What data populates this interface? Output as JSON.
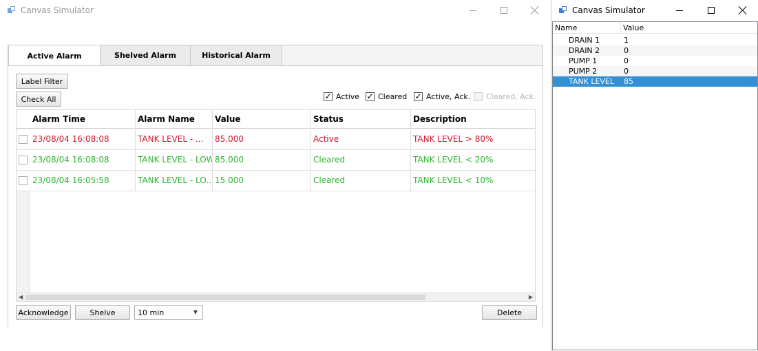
{
  "main_window": {
    "title": "Canvas Simulator",
    "tabs": [
      {
        "label": "Active Alarm",
        "active": true
      },
      {
        "label": "Shelved Alarm",
        "active": false
      },
      {
        "label": "Historical Alarm",
        "active": false
      }
    ],
    "buttons": {
      "label_filter": "Label Filter",
      "check_all": "Check All",
      "acknowledge": "Acknowledge",
      "shelve": "Shelve",
      "delete": "Delete"
    },
    "filters": [
      {
        "label": "Active",
        "checked": true,
        "enabled": true
      },
      {
        "label": "Cleared",
        "checked": true,
        "enabled": true
      },
      {
        "label": "Active, Ack.",
        "checked": true,
        "enabled": true
      },
      {
        "label": "Cleared, Ack.",
        "checked": false,
        "enabled": false
      }
    ],
    "shelve_duration": "10 min",
    "table": {
      "columns": [
        "Alarm Time",
        "Alarm Name",
        "Value",
        "Status",
        "Description"
      ],
      "rows": [
        {
          "time": "23/08/04 16:08:08",
          "name": "TANK LEVEL - ...",
          "value": "85.000",
          "status": "Active",
          "description": "TANK LEVEL > 80%",
          "color": "#c8192a"
        },
        {
          "time": "23/08/04 16:08:08",
          "name": "TANK LEVEL - LOW",
          "value": "85.000",
          "status": "Cleared",
          "description": "TANK LEVEL < 20%",
          "color": "#2db52d"
        },
        {
          "time": "23/08/04 16:05:58",
          "name": "TANK LEVEL - LO...",
          "value": "15.000",
          "status": "Cleared",
          "description": "TANK LEVEL < 10%",
          "color": "#2db52d"
        }
      ]
    }
  },
  "side_window": {
    "title": "Canvas Simulator",
    "columns": [
      "Name",
      "Value"
    ],
    "rows": [
      {
        "name": "DRAIN 1",
        "value": "1"
      },
      {
        "name": "DRAIN 2",
        "value": "0"
      },
      {
        "name": "PUMP 1",
        "value": "0"
      },
      {
        "name": "PUMP 2",
        "value": "0"
      },
      {
        "name": "TANK LEVEL",
        "value": "85"
      }
    ],
    "selected_row": "TANK LEVEL"
  },
  "colors": {
    "active_alarm": "#c8192a",
    "cleared_alarm": "#2db52d",
    "selection": "#3390d4"
  }
}
